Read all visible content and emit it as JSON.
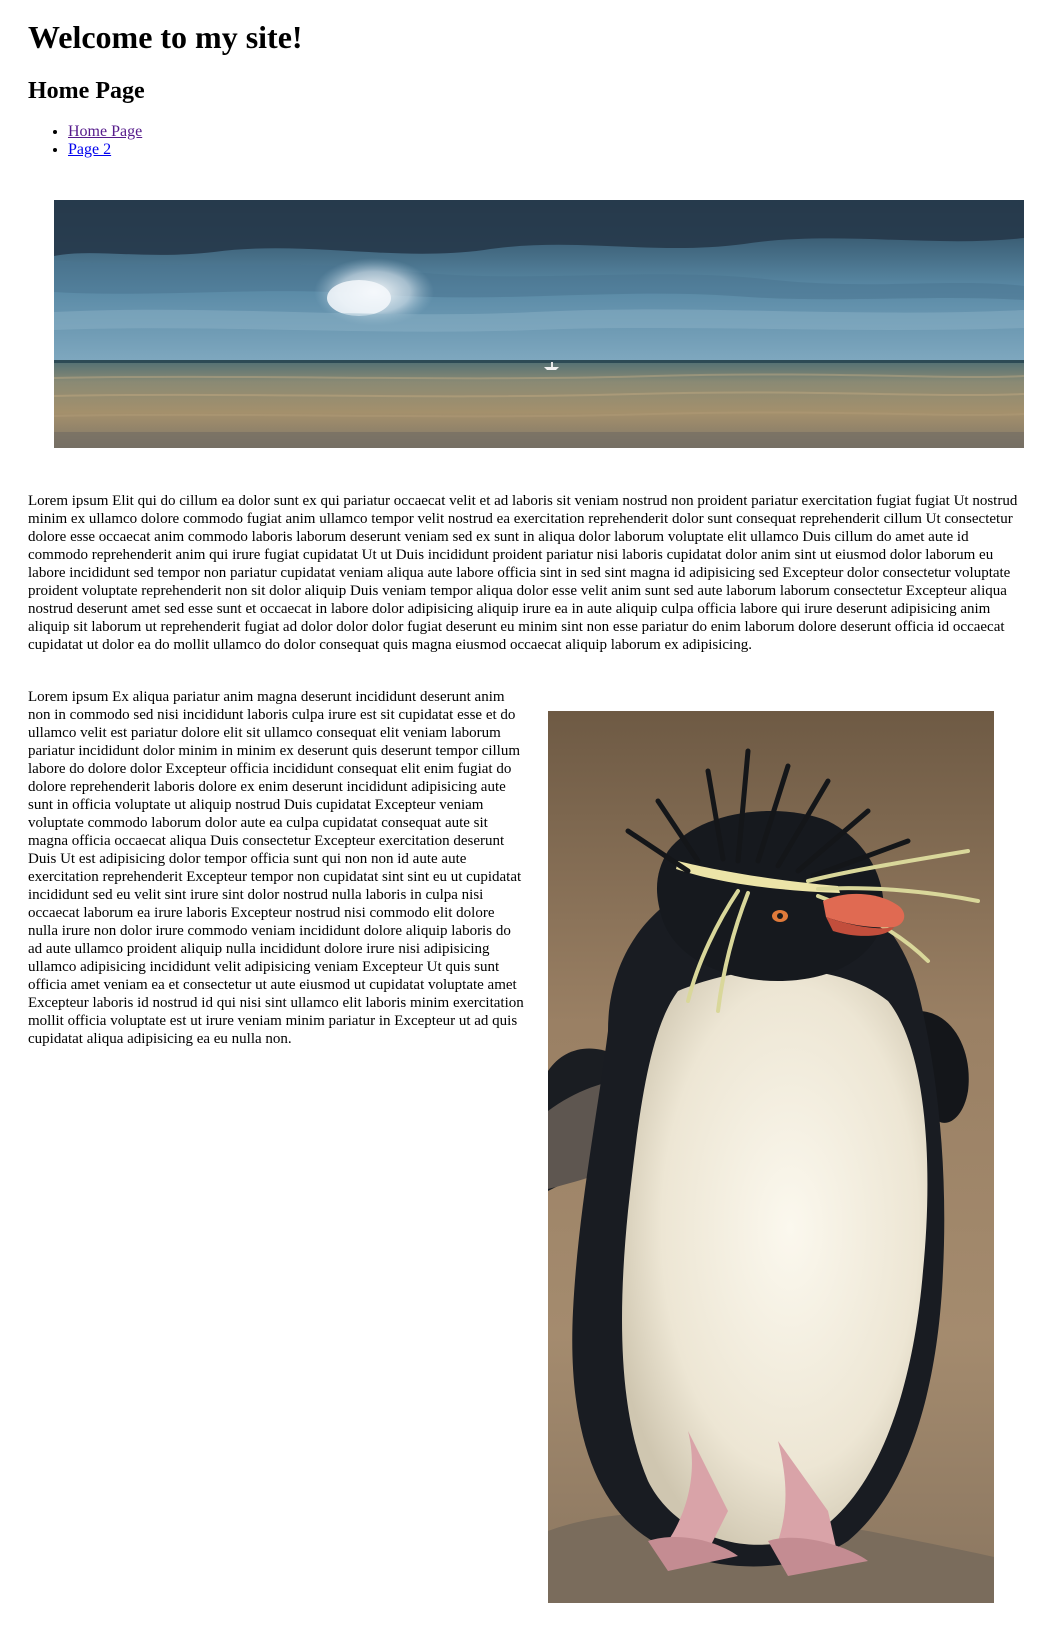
{
  "header": {
    "site_title": "Welcome to my site!",
    "page_heading": "Home Page"
  },
  "nav": {
    "items": [
      {
        "label": "Home Page"
      },
      {
        "label": "Page 2"
      }
    ]
  },
  "banner": {
    "alt": "Seascape with clouds and a boat on the horizon"
  },
  "content": {
    "paragraph_1": "Lorem ipsum Elit qui do cillum ea dolor sunt ex qui pariatur occaecat velit et ad laboris sit veniam nostrud non proident pariatur exercitation fugiat fugiat Ut nostrud minim ex ullamco dolore commodo fugiat anim ullamco tempor velit nostrud ea exercitation reprehenderit dolor sunt consequat reprehenderit cillum Ut consectetur dolore esse occaecat anim commodo laboris laborum deserunt veniam sed ex sunt in aliqua dolor laborum voluptate elit ullamco Duis cillum do amet aute id commodo reprehenderit anim qui irure fugiat cupidatat Ut ut Duis incididunt proident pariatur nisi laboris cupidatat dolor anim sint ut eiusmod dolor laborum eu labore incididunt sed tempor non pariatur cupidatat veniam aliqua aute labore officia sint in sed sint magna id adipisicing sed Excepteur dolor consectetur voluptate proident voluptate reprehenderit non sit dolor aliquip Duis veniam tempor aliqua dolor esse velit anim sunt sed aute laborum laborum consectetur Excepteur aliqua nostrud deserunt amet sed esse sunt et occaecat in labore dolor adipisicing aliquip irure ea in aute aliquip culpa officia labore qui irure deserunt adipisicing anim aliquip sit laborum ut reprehenderit fugiat ad dolor dolor dolor fugiat deserunt eu minim sint non esse pariatur do enim laborum dolore deserunt officia id occaecat cupidatat ut dolor ea do mollit ullamco do dolor consequat quis magna eiusmod occaecat aliquip laborum ex adipisicing.",
    "paragraph_2": "Lorem ipsum Ex aliqua pariatur anim magna deserunt incididunt deserunt anim non in commodo sed nisi incididunt laboris culpa irure est sit cupidatat esse et do ullamco velit est pariatur dolore elit sit ullamco consequat elit veniam laborum pariatur incididunt dolor minim in minim ex deserunt quis deserunt tempor cillum labore do dolore dolor Excepteur officia incididunt consequat elit enim fugiat do dolore reprehenderit laboris dolore ex enim deserunt incididunt adipisicing aute sunt in officia voluptate ut aliquip nostrud Duis cupidatat Excepteur veniam voluptate commodo laborum dolor aute ea culpa cupidatat consequat aute sit magna officia occaecat aliqua Duis consectetur Excepteur exercitation deserunt Duis Ut est adipisicing dolor tempor officia sunt qui non non id aute aute exercitation reprehenderit Excepteur tempor non cupidatat sint sint eu ut cupidatat incididunt sed eu velit sint irure sint dolor nostrud nulla laboris in culpa nisi occaecat laborum ea irure laboris Excepteur nostrud nisi commodo elit dolore nulla irure non dolor irure commodo veniam incididunt dolore aliquip laboris do ad aute ullamco proident aliquip nulla incididunt dolore irure nisi adipisicing ullamco adipisicing incididunt velit adipisicing veniam Excepteur Ut quis sunt officia amet veniam ea et consectetur ut aute eiusmod ut cupidatat voluptate amet Excepteur laboris id nostrud id qui nisi sint ullamco elit laboris minim exercitation mollit officia voluptate est ut irure veniam minim pariatur in Excepteur ut ad quis cupidatat aliqua adipisicing ea eu nulla non."
  },
  "penguin_image": {
    "alt": "Rockhopper penguin"
  },
  "colors": {
    "link": "#0000ee",
    "link_visited": "#551a8b",
    "text": "#000000",
    "background": "#ffffff"
  }
}
